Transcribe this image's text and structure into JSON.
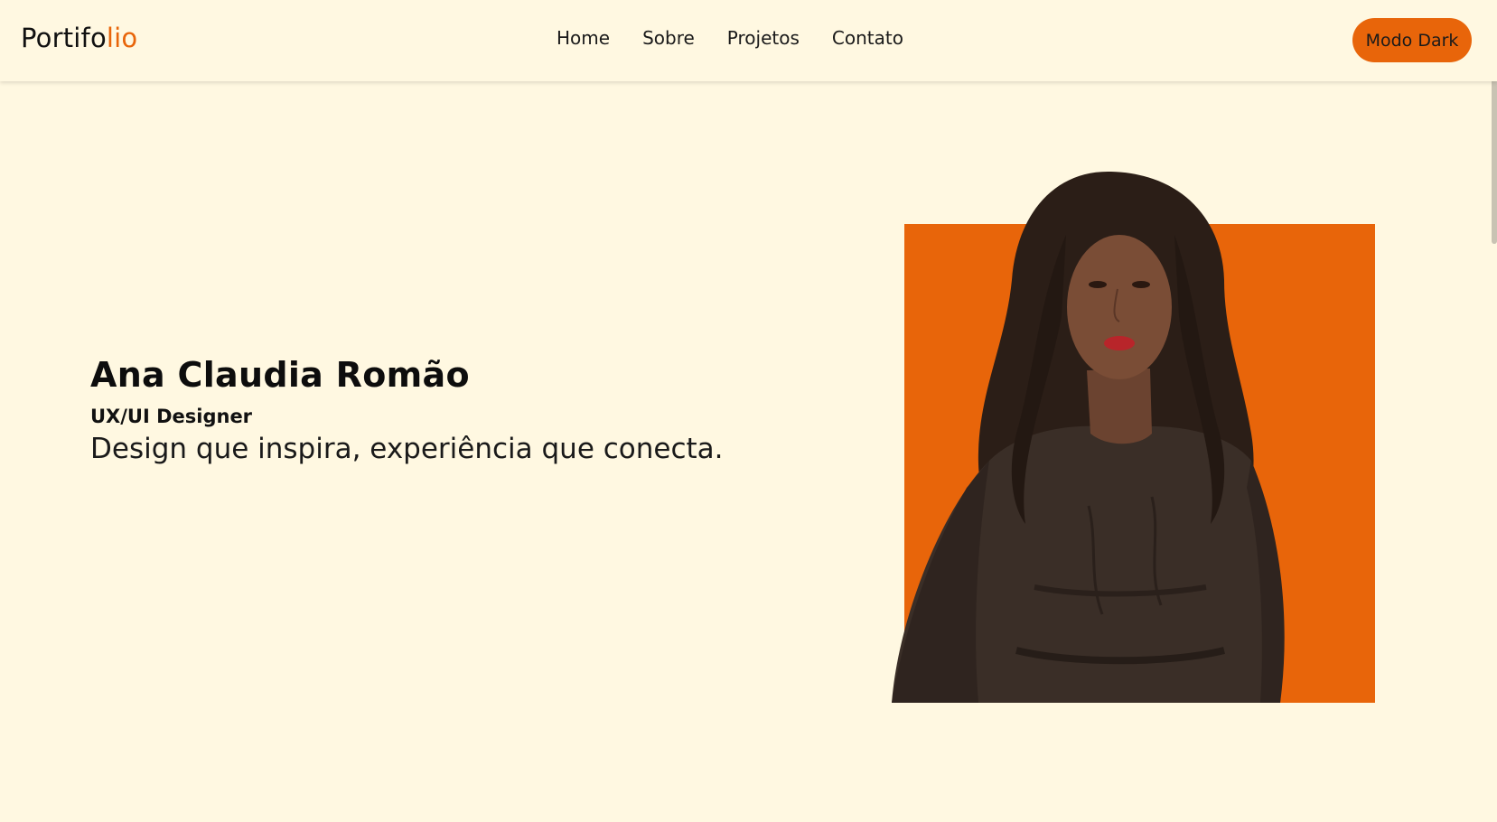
{
  "header": {
    "logo_main": "Portifo",
    "logo_accent": "lio",
    "nav": [
      "Home",
      "Sobre",
      "Projetos",
      "Contato"
    ],
    "mode_button": "Modo Dark"
  },
  "hero": {
    "name": "Ana Claudia Romão",
    "role": "UX/UI Designer",
    "tagline": "Design que inspira, experiência que conecta."
  },
  "colors": {
    "accent": "#e8650a",
    "background": "#fff8e1"
  }
}
